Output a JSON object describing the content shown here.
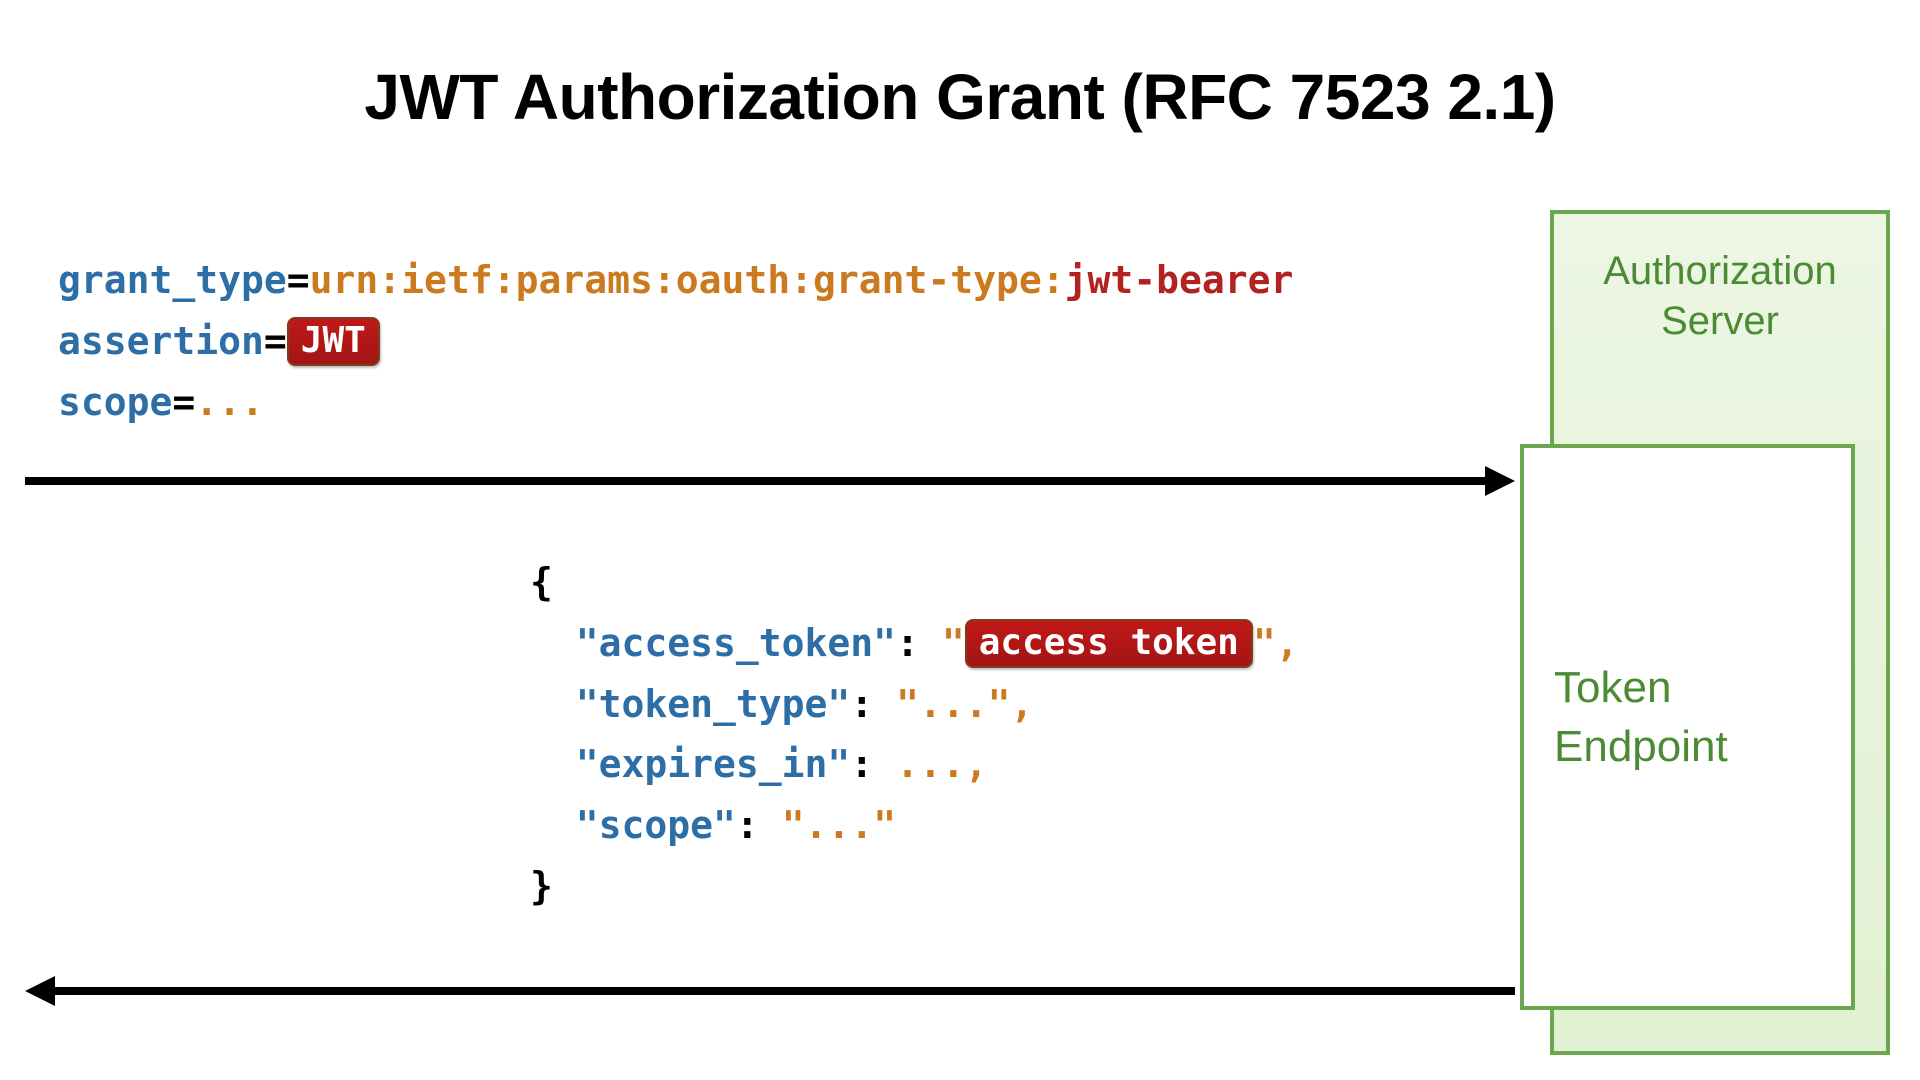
{
  "title": "JWT Authorization Grant (RFC 7523 2.1)",
  "request": {
    "grant_type_key": "grant_type",
    "grant_type_prefix": "urn:ietf:params:oauth:grant-type:",
    "grant_type_suffix": "jwt-bearer",
    "assertion_key": "assertion",
    "assertion_badge": "JWT",
    "scope_key": "scope",
    "scope_value": "...",
    "equals": "="
  },
  "response": {
    "open_brace": "{",
    "close_brace": "}",
    "access_token_key": "\"access_token\"",
    "access_token_pre": "\"",
    "access_token_badge": "access token",
    "access_token_post": "\",",
    "token_type_key": "\"token_type\"",
    "token_type_val": "\"...\",",
    "expires_in_key": "\"expires_in\"",
    "expires_in_val": "...,",
    "scope_key": "\"scope\"",
    "scope_val": "\"...\"",
    "colon": ":"
  },
  "boxes": {
    "auth_server": "Authorization\nServer",
    "token_endpoint": "Token\nEndpoint"
  }
}
